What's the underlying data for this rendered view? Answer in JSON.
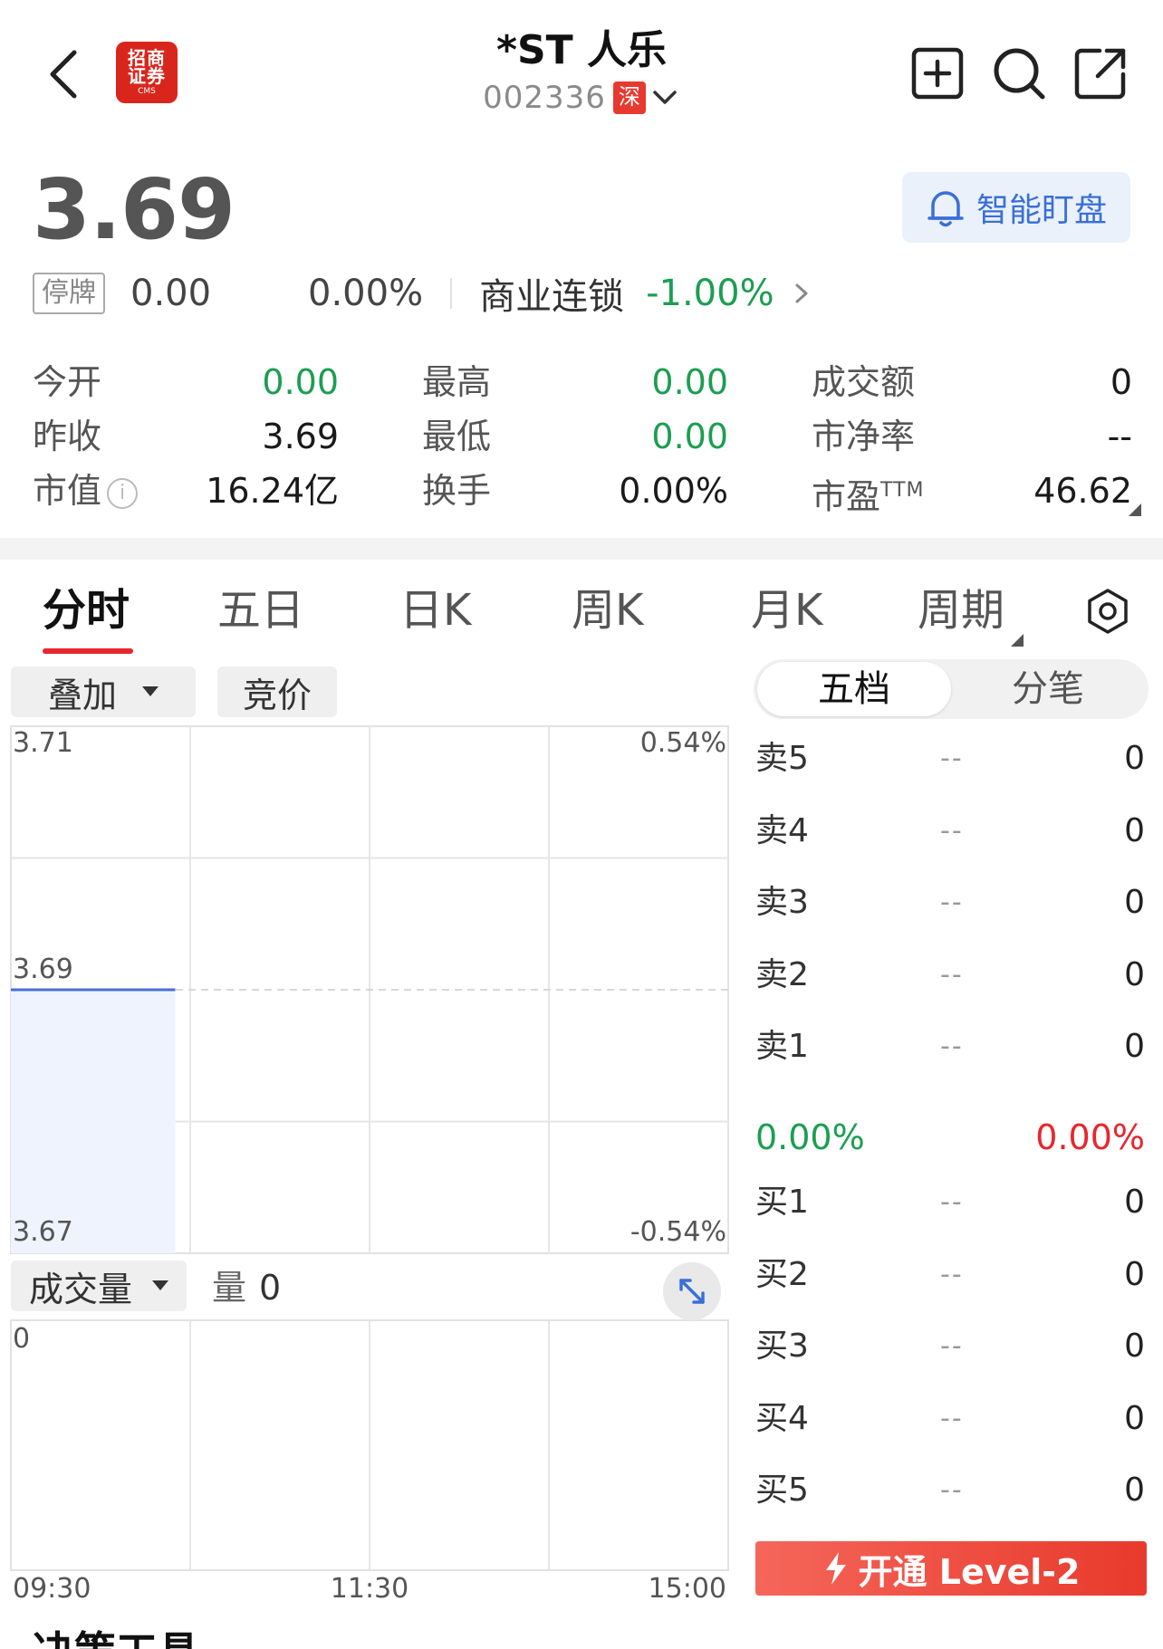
{
  "header": {
    "stock_name": "*ST 人乐",
    "stock_code": "002336",
    "market_badge": "深",
    "logo_line1": "招商",
    "logo_line2": "证券",
    "logo_line3": "CMS"
  },
  "price": {
    "current": "3.69",
    "status_badge": "停牌",
    "change": "0.00",
    "change_pct": "0.00%",
    "sector_name": "商业连锁",
    "sector_pct": "-1.00%",
    "smart_monitor_label": "智能盯盘"
  },
  "quote": {
    "open_label": "今开",
    "open_value": "0.00",
    "high_label": "最高",
    "high_value": "0.00",
    "turnover_label": "成交额",
    "turnover_value": "0",
    "prev_close_label": "昨收",
    "prev_close_value": "3.69",
    "low_label": "最低",
    "low_value": "0.00",
    "pb_label": "市净率",
    "pb_value": "--",
    "mkt_cap_label": "市值",
    "mkt_cap_value": "16.24亿",
    "turnover_rate_label": "换手",
    "turnover_rate_value": "0.00%",
    "pe_label": "市盈",
    "pe_suffix": "TTM",
    "pe_value": "46.62"
  },
  "tabs": [
    "分时",
    "五日",
    "日K",
    "周K",
    "月K",
    "周期"
  ],
  "active_tab": "分时",
  "chart_controls": {
    "overlay_label": "叠加",
    "auction_label": "竞价",
    "volume_selector": "成交量",
    "volume_readout_label": "量",
    "volume_readout_value": "0"
  },
  "chart_data": {
    "type": "line",
    "price_axis": {
      "top": "3.71",
      "mid": "3.69",
      "bottom": "3.67",
      "ylim": [
        3.67,
        3.71
      ]
    },
    "pct_axis": {
      "top": "0.54%",
      "bottom": "-0.54%"
    },
    "x_ticks": [
      "09:30",
      "11:30",
      "15:00"
    ],
    "prev_close": 3.69,
    "series": [
      {
        "x": [
          "09:30",
          "10:25"
        ],
        "values": [
          3.69,
          3.69
        ]
      }
    ],
    "volume_axis_top": "0",
    "grid": true
  },
  "order_book": {
    "tabs": [
      "五档",
      "分笔"
    ],
    "active_tab": "五档",
    "asks": [
      {
        "label": "卖5",
        "price": "--",
        "volume": "0"
      },
      {
        "label": "卖4",
        "price": "--",
        "volume": "0"
      },
      {
        "label": "卖3",
        "price": "--",
        "volume": "0"
      },
      {
        "label": "卖2",
        "price": "--",
        "volume": "0"
      },
      {
        "label": "卖1",
        "price": "--",
        "volume": "0"
      }
    ],
    "ratio_left": "0.00%",
    "ratio_right": "0.00%",
    "bids": [
      {
        "label": "买1",
        "price": "--",
        "volume": "0"
      },
      {
        "label": "买2",
        "price": "--",
        "volume": "0"
      },
      {
        "label": "买3",
        "price": "--",
        "volume": "0"
      },
      {
        "label": "买4",
        "price": "--",
        "volume": "0"
      },
      {
        "label": "买5",
        "price": "--",
        "volume": "0"
      }
    ],
    "level2_label": "开通 Level-2"
  },
  "bottom_partial": "决策工具",
  "colors": {
    "up": "#e8262d",
    "down": "#1c9e52",
    "line": "#4a6fd4",
    "fill": "#eef3fd"
  }
}
